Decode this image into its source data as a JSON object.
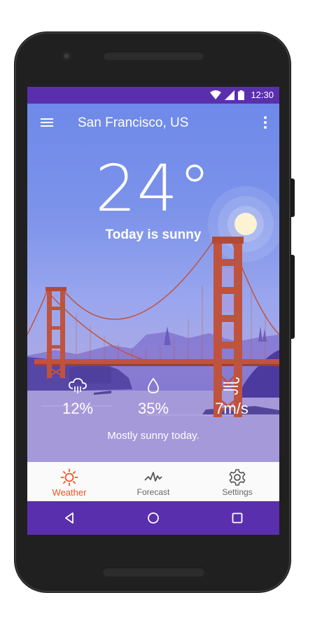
{
  "status_bar": {
    "time": "12:30"
  },
  "app_bar": {
    "title": "San Francisco, US"
  },
  "weather": {
    "temperature": "24°",
    "summary": "Today is sunny",
    "description": "Mostly sunny today."
  },
  "stats": {
    "rain": {
      "icon": "rain-cloud-icon",
      "value": "12%"
    },
    "humidity": {
      "icon": "water-drop-icon",
      "value": "35%"
    },
    "wind": {
      "icon": "wind-icon",
      "value": "7m/s"
    }
  },
  "bottom_nav": {
    "items": [
      {
        "label": "Weather",
        "icon": "sun-icon",
        "active": true
      },
      {
        "label": "Forecast",
        "icon": "graph-icon",
        "active": false
      },
      {
        "label": "Settings",
        "icon": "gear-icon",
        "active": false
      }
    ]
  },
  "colors": {
    "status_bar": "#5a2fad",
    "active_tab": "#f4511e",
    "bridge": "#c0533e"
  }
}
